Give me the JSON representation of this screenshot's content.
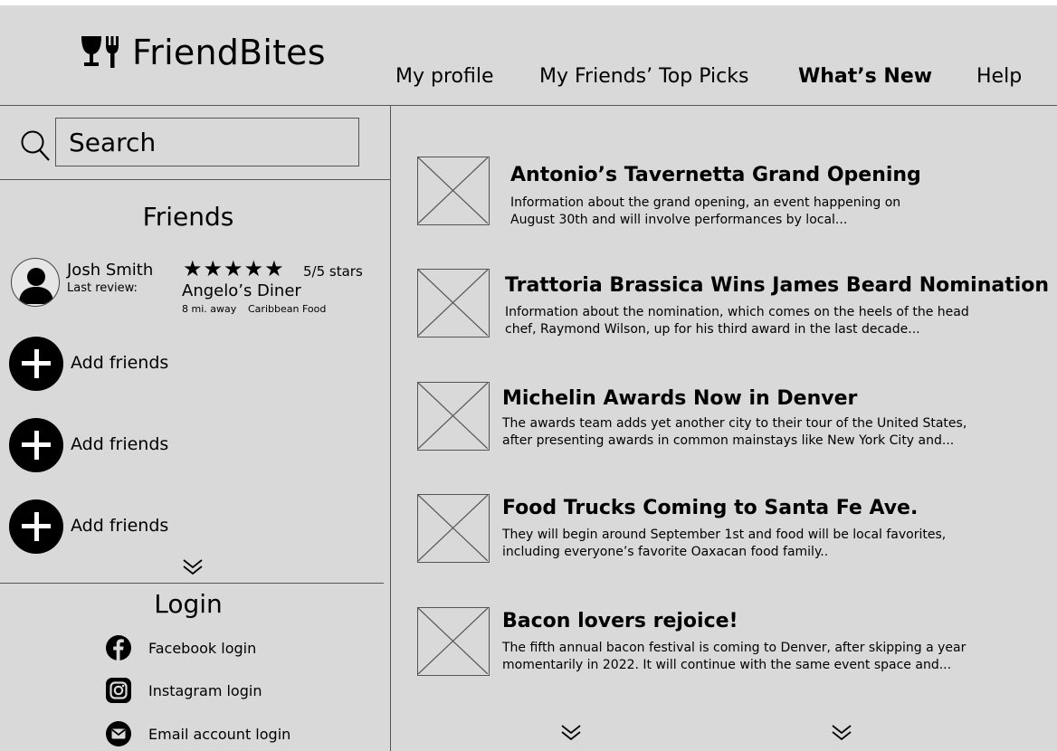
{
  "app": {
    "name": "FriendBites"
  },
  "nav": [
    {
      "label": "My profile"
    },
    {
      "label": "My Friends’ Top Picks"
    },
    {
      "label": "What’s New",
      "active": true
    },
    {
      "label": "Help"
    }
  ],
  "search": {
    "placeholder": "Search"
  },
  "friends": {
    "title": "Friends",
    "friend": {
      "name": "Josh Smith",
      "last_review_label": "Last review:",
      "stars": "★★★★★",
      "rating": "5/5 stars",
      "restaurant": "Angelo’s Diner",
      "distance": "8 mi. away",
      "cuisine": "Caribbean Food"
    },
    "add_label": "Add friends"
  },
  "login": {
    "title": "Login",
    "options": [
      {
        "label": "Facebook login",
        "icon": "facebook-icon"
      },
      {
        "label": "Instagram login",
        "icon": "instagram-icon"
      },
      {
        "label": "Email account login",
        "icon": "email-icon"
      }
    ]
  },
  "news": [
    {
      "title": "Antonio’s Tavernetta Grand Opening",
      "line1": "Information about the grand opening, an event happening on",
      "line2": "August 30th and will involve performances by local..."
    },
    {
      "title": "Trattoria Brassica Wins James Beard Nomination",
      "line1": "Information about the nomination, which comes on the heels of the head",
      "line2": "chef, Raymond Wilson, up for his third award in the last decade..."
    },
    {
      "title": "Michelin Awards Now in Denver",
      "line1": "The awards team adds yet another city to their tour of the United States,",
      "line2": "after presenting awards in common mainstays like New York City and..."
    },
    {
      "title": "Food Trucks Coming to Santa Fe Ave.",
      "line1": "They will begin around September 1st and food will be local favorites,",
      "line2": "including everyone’s favorite Oaxacan food family.."
    },
    {
      "title": "Bacon lovers rejoice!",
      "line1": "The fifth annual bacon festival is coming to Denver, after skipping a year",
      "line2": "momentarily in 2022. It will continue with the same event space and..."
    }
  ]
}
